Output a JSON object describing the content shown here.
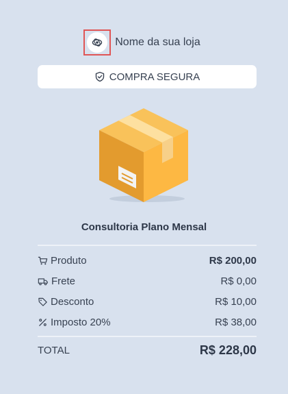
{
  "store": {
    "name": "Nome da sua loja",
    "logo_icon": "store-logo-icon"
  },
  "badge": {
    "label": "COMPRA SEGURA",
    "icon": "shield-check-icon"
  },
  "product": {
    "image": "cardboard-box",
    "title": "Consultoria Plano Mensal"
  },
  "summary": {
    "rows": [
      {
        "icon": "cart-icon",
        "label": "Produto",
        "value": "R$ 200,00"
      },
      {
        "icon": "truck-icon",
        "label": "Frete",
        "value": "R$ 0,00"
      },
      {
        "icon": "tag-icon",
        "label": "Desconto",
        "value": "R$ 10,00"
      },
      {
        "icon": "percent-icon",
        "label": "Imposto 20%",
        "value": "R$ 38,00"
      }
    ],
    "total_label": "TOTAL",
    "total_value": "R$ 228,00"
  },
  "colors": {
    "background": "#d8e1ee",
    "card": "#ffffff",
    "text": "#374151",
    "box_front": "#f0a93a",
    "box_side": "#e39b2e",
    "box_top": "#f9c25a",
    "highlight_border": "#e05555"
  }
}
